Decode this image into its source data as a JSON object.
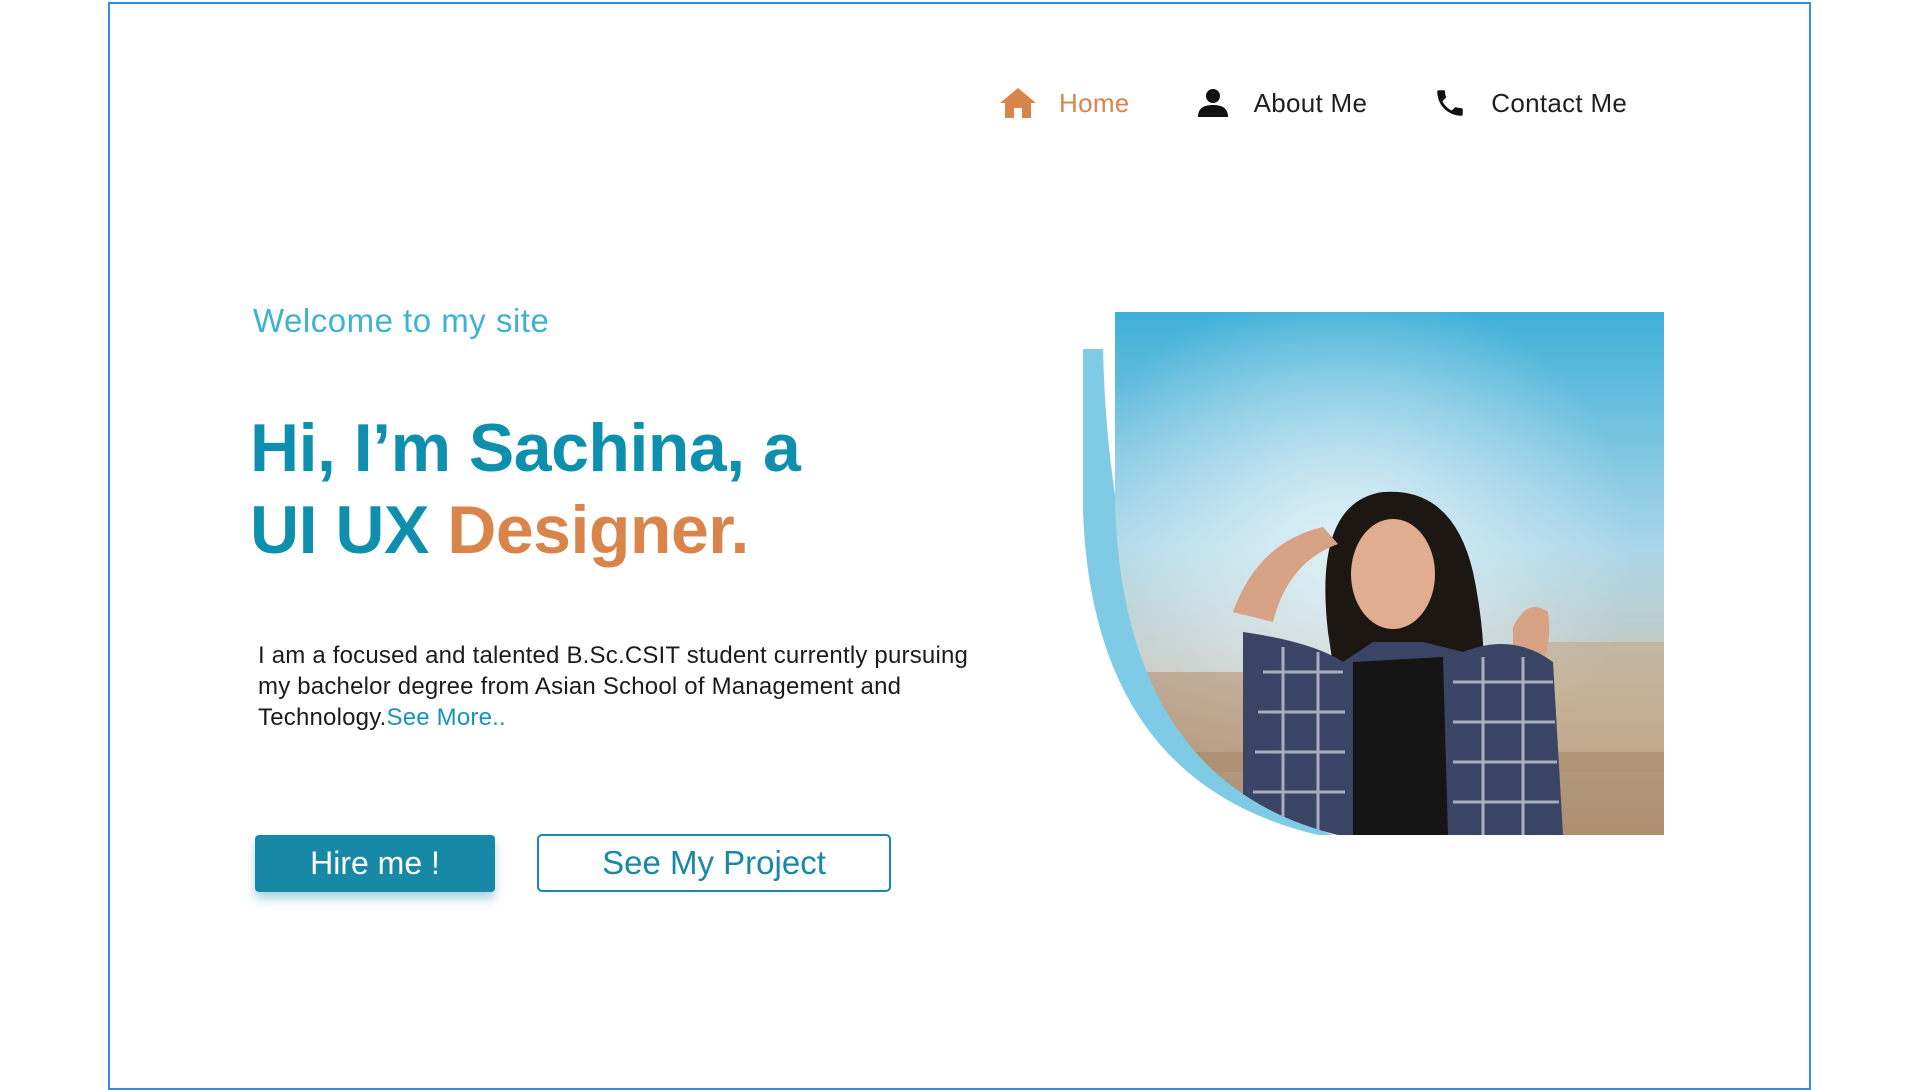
{
  "nav": {
    "items": [
      {
        "label": "Home",
        "icon": "home-icon",
        "active": true
      },
      {
        "label": "About Me",
        "icon": "person-icon",
        "active": false
      },
      {
        "label": "Contact Me",
        "icon": "phone-icon",
        "active": false
      }
    ]
  },
  "hero": {
    "welcome": "Welcome to my site",
    "headline_line1": "Hi, I’m Sachina, a",
    "headline_line2_start": "UI UX ",
    "headline_line2_accent": "Designer.",
    "description": "I am a focused and talented B.Sc.CSIT student currently pursuing my bachelor degree from Asian School of Management and Technology.",
    "see_more": "See More.."
  },
  "buttons": {
    "hire": "Hire me !",
    "project": "See My Project"
  },
  "colors": {
    "brand_blue": "#1789a7",
    "accent_orange": "#d9844a",
    "light_blue": "#3fb2d2",
    "frame_border": "#2f8fe0"
  },
  "image": {
    "subject": "portrait-photo"
  }
}
